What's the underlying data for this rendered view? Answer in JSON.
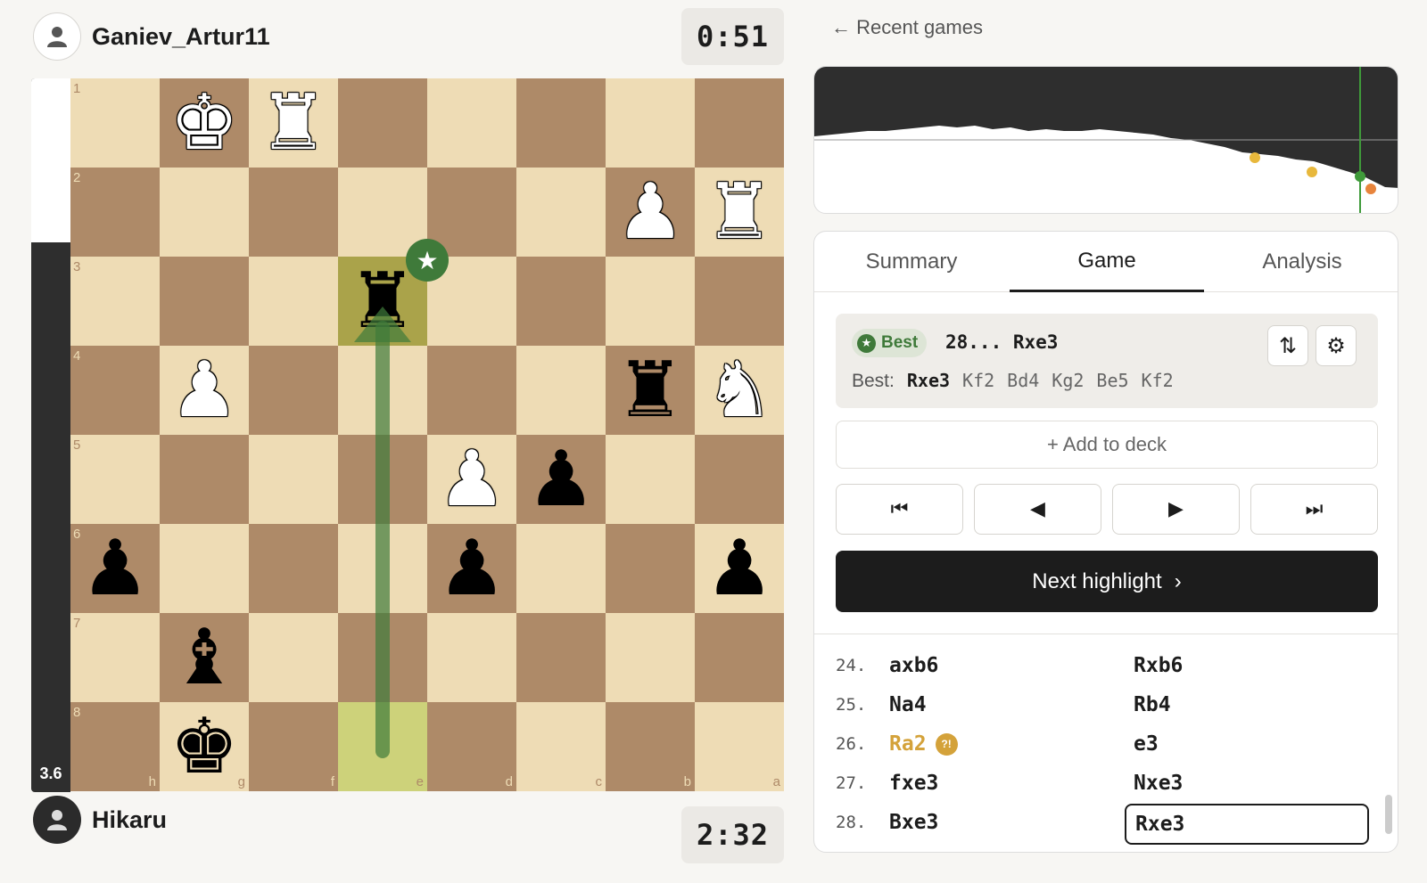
{
  "players": {
    "top": {
      "name": "Ganiev_Artur11",
      "clock": "0:51"
    },
    "bottom": {
      "name": "Hikaru",
      "clock": "2:32"
    }
  },
  "eval": {
    "value": "3.6",
    "white_share": 0.23
  },
  "board": {
    "ranks": [
      "1",
      "2",
      "3",
      "4",
      "5",
      "6",
      "7",
      "8"
    ],
    "files": [
      "h",
      "g",
      "f",
      "e",
      "d",
      "c",
      "b",
      "a"
    ],
    "pieces": [
      {
        "sq": "g1",
        "piece": "king",
        "color": "white"
      },
      {
        "sq": "f1",
        "piece": "rook",
        "color": "white"
      },
      {
        "sq": "b2",
        "piece": "pawn",
        "color": "white"
      },
      {
        "sq": "a2",
        "piece": "rook",
        "color": "white"
      },
      {
        "sq": "e3",
        "piece": "rook",
        "color": "black"
      },
      {
        "sq": "g4",
        "piece": "pawn",
        "color": "white"
      },
      {
        "sq": "b4",
        "piece": "rook",
        "color": "black"
      },
      {
        "sq": "a4",
        "piece": "knight",
        "color": "white"
      },
      {
        "sq": "d5",
        "piece": "pawn",
        "color": "white"
      },
      {
        "sq": "c5",
        "piece": "pawn",
        "color": "black"
      },
      {
        "sq": "h6",
        "piece": "pawn",
        "color": "black"
      },
      {
        "sq": "d6",
        "piece": "pawn",
        "color": "black"
      },
      {
        "sq": "a6",
        "piece": "pawn",
        "color": "black"
      },
      {
        "sq": "g7",
        "piece": "bishop",
        "color": "black"
      },
      {
        "sq": "g8",
        "piece": "king",
        "color": "black"
      }
    ],
    "highlights": [
      "e3",
      "e8"
    ],
    "arrow": {
      "from": "e8",
      "to": "e3",
      "color": "#3f7a3a"
    },
    "badge_square": "e3",
    "badge_icon": "star-icon",
    "colors": {
      "light": "#eedcb5",
      "dark": "#ae8a68",
      "accent": "#3f7a3a"
    }
  },
  "nav": {
    "back_label": "Recent games",
    "back_icon": "arrow-left-icon"
  },
  "tabs": [
    {
      "label": "Summary",
      "active": false
    },
    {
      "label": "Game",
      "active": true
    },
    {
      "label": "Analysis",
      "active": false
    }
  ],
  "current_move": {
    "badge": "Best",
    "badge_color": "#3f7a3a",
    "move": "28... Rxe3",
    "best_label": "Best:",
    "best_line": [
      "Rxe3",
      "Kf2",
      "Bd4",
      "Kg2",
      "Be5",
      "Kf2"
    ],
    "flip_icon": "swap-vertical-icon",
    "settings_icon": "gear-icon"
  },
  "add_to_deck": "+ Add to deck",
  "controls": [
    "first-move-icon",
    "previous-move-icon",
    "next-move-icon",
    "last-move-icon"
  ],
  "next_highlight": {
    "label": "Next highlight",
    "icon": "chevron-right-icon"
  },
  "moves": [
    {
      "num": "24.",
      "white": "axb6",
      "black": "Rxb6"
    },
    {
      "num": "25.",
      "white": "Na4",
      "black": "Rb4"
    },
    {
      "num": "26.",
      "white": "Ra2",
      "white_mark": "?!",
      "white_color": "#d4a23a",
      "black": "e3"
    },
    {
      "num": "27.",
      "white": "fxe3",
      "black": "Nxe3"
    },
    {
      "num": "28.",
      "white": "Bxe3",
      "black": "Rxe3",
      "black_selected": true
    }
  ]
}
